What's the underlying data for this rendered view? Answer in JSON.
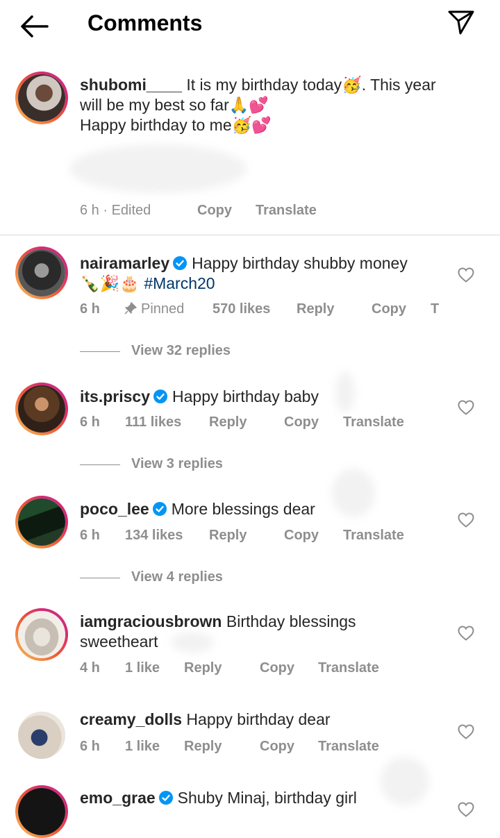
{
  "header": {
    "title": "Comments"
  },
  "caption": {
    "username": "shubomi____",
    "text_line1": "It is my birthday today🥳. This year",
    "text_line2": "will be my best so far🙏💕",
    "text_line3": "Happy birthday to me🥳💕",
    "time": "6 h · Edited",
    "copy": "Copy",
    "translate": "Translate"
  },
  "comments": [
    {
      "username": "nairamarley",
      "verified": true,
      "text": "Happy birthday shubby money",
      "text_line2": "🍾🎉🎂",
      "hashtag": "#March20",
      "time": "6 h",
      "pinned": "Pinned",
      "likes": "570 likes",
      "reply": "Reply",
      "copy": "Copy",
      "translate": "T",
      "view_replies": "View 32 replies"
    },
    {
      "username": "its.priscy",
      "verified": true,
      "text": "Happy birthday baby",
      "time": "6 h",
      "likes": "111 likes",
      "reply": "Reply",
      "copy": "Copy",
      "translate": "Translate",
      "view_replies": "View 3 replies"
    },
    {
      "username": "poco_lee",
      "verified": true,
      "text": "More blessings dear",
      "time": "6 h",
      "likes": "134 likes",
      "reply": "Reply",
      "copy": "Copy",
      "translate": "Translate",
      "view_replies": "View 4 replies"
    },
    {
      "username": "iamgraciousbrown",
      "verified": false,
      "text": "Birthday blessings",
      "text_line2": "sweetheart",
      "time": "4 h",
      "likes": "1 like",
      "reply": "Reply",
      "copy": "Copy",
      "translate": "Translate"
    },
    {
      "username": "creamy_dolls",
      "verified": false,
      "text": "Happy birthday dear",
      "time": "6 h",
      "likes": "1 like",
      "reply": "Reply",
      "copy": "Copy",
      "translate": "Translate"
    },
    {
      "username": "emo_grae",
      "verified": true,
      "text": "Shuby Minaj, birthday girl"
    }
  ],
  "colors": {
    "verified": "#0095f6",
    "hashtag": "#00376b",
    "meta": "#8e8e8e"
  }
}
